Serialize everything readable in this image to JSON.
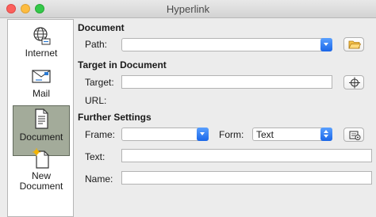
{
  "window": {
    "title": "Hyperlink"
  },
  "sidebar": {
    "items": [
      {
        "label": "Internet",
        "icon": "globe-icon"
      },
      {
        "label": "Mail",
        "icon": "envelope-icon"
      },
      {
        "label": "Document",
        "icon": "document-icon",
        "selected": true
      },
      {
        "label": "New\nDocument",
        "icon": "new-document-icon"
      }
    ]
  },
  "document_section": {
    "title": "Document",
    "path_label": "Path:",
    "path_value": "",
    "open_file_icon": "folder-open-icon"
  },
  "target_section": {
    "title": "Target in Document",
    "target_label": "Target:",
    "target_value": "",
    "target_button_icon": "target-icon",
    "url_label": "URL:",
    "url_value": ""
  },
  "further_settings": {
    "title": "Further Settings",
    "frame_label": "Frame:",
    "frame_value": "",
    "form_label": "Form:",
    "form_value": "Text",
    "events_button_icon": "events-icon",
    "text_label": "Text:",
    "text_value": "",
    "name_label": "Name:",
    "name_value": ""
  },
  "colors": {
    "selected_item_bg": "#a3ab9a",
    "dropdown_accent": "#1a66e8"
  }
}
